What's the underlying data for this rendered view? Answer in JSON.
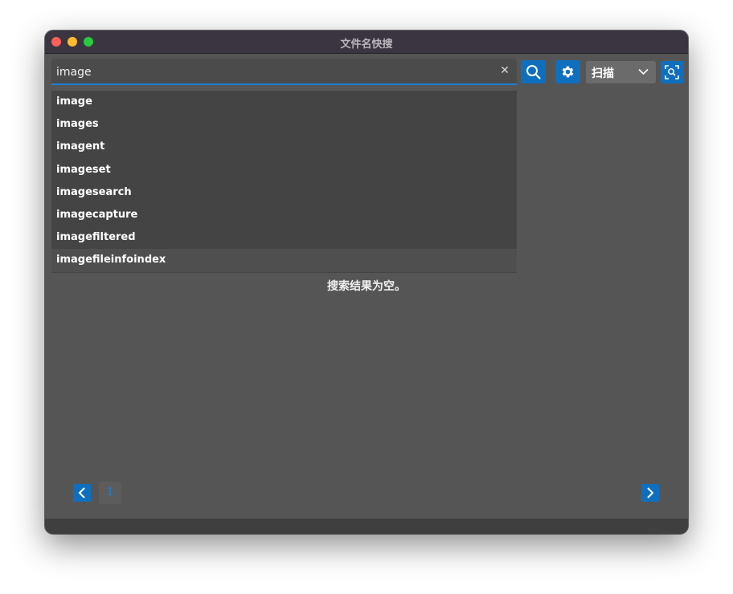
{
  "window": {
    "title": "文件名快搜"
  },
  "search": {
    "value": "image",
    "clear_glyph": "✕"
  },
  "toolbar": {
    "search_icon": "search-icon",
    "settings_icon": "gear-icon",
    "scan_mode": "扫描",
    "scan_icon": "scan-icon"
  },
  "suggestions": [
    "image",
    "images",
    "imagent",
    "imageset",
    "imagesearch",
    "imagecapture",
    "imagefiltered",
    "imagefileinfoindex"
  ],
  "results": {
    "empty_message": "搜索结果为空。"
  },
  "pager": {
    "current_page": "1"
  },
  "colors": {
    "accent": "#0f6fbf",
    "window_bg": "#555555",
    "titlebar_bg": "#3a3540",
    "suggestion_bg": "#444444"
  }
}
